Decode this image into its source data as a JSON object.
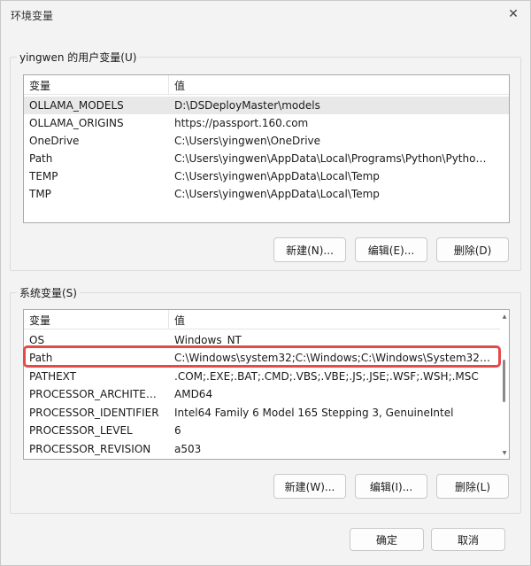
{
  "window": {
    "title": "环境变量",
    "close_glyph": "✕"
  },
  "user_vars": {
    "group_label": "yingwen 的用户变量(U)",
    "col_name": "变量",
    "col_value": "值",
    "rows": [
      {
        "name": "OLLAMA_MODELS",
        "value": "D:\\DSDeployMaster\\models"
      },
      {
        "name": "OLLAMA_ORIGINS",
        "value": "https://passport.160.com"
      },
      {
        "name": "OneDrive",
        "value": "C:\\Users\\yingwen\\OneDrive"
      },
      {
        "name": "Path",
        "value": "C:\\Users\\yingwen\\AppData\\Local\\Programs\\Python\\Python31..."
      },
      {
        "name": "TEMP",
        "value": "C:\\Users\\yingwen\\AppData\\Local\\Temp"
      },
      {
        "name": "TMP",
        "value": "C:\\Users\\yingwen\\AppData\\Local\\Temp"
      }
    ],
    "new_label": "新建(N)...",
    "edit_label": "编辑(E)...",
    "delete_label": "删除(D)"
  },
  "system_vars": {
    "group_label": "系统变量(S)",
    "col_name": "变量",
    "col_value": "值",
    "rows": [
      {
        "name": "OS",
        "value": "Windows_NT"
      },
      {
        "name": "Path",
        "value": "C:\\Windows\\system32;C:\\Windows;C:\\Windows\\System32\\Wb..."
      },
      {
        "name": "PATHEXT",
        "value": ".COM;.EXE;.BAT;.CMD;.VBS;.VBE;.JS;.JSE;.WSF;.WSH;.MSC"
      },
      {
        "name": "PROCESSOR_ARCHITECT...",
        "value": "AMD64"
      },
      {
        "name": "PROCESSOR_IDENTIFIER",
        "value": "Intel64 Family 6 Model 165 Stepping 3, GenuineIntel"
      },
      {
        "name": "PROCESSOR_LEVEL",
        "value": "6"
      },
      {
        "name": "PROCESSOR_REVISION",
        "value": "a503"
      }
    ],
    "new_label": "新建(W)...",
    "edit_label": "编辑(I)...",
    "delete_label": "删除(L)"
  },
  "footer": {
    "ok_label": "确定",
    "cancel_label": "取消"
  },
  "colors": {
    "highlight": "#e34b4b",
    "selected_row": "#e8e8e8"
  }
}
